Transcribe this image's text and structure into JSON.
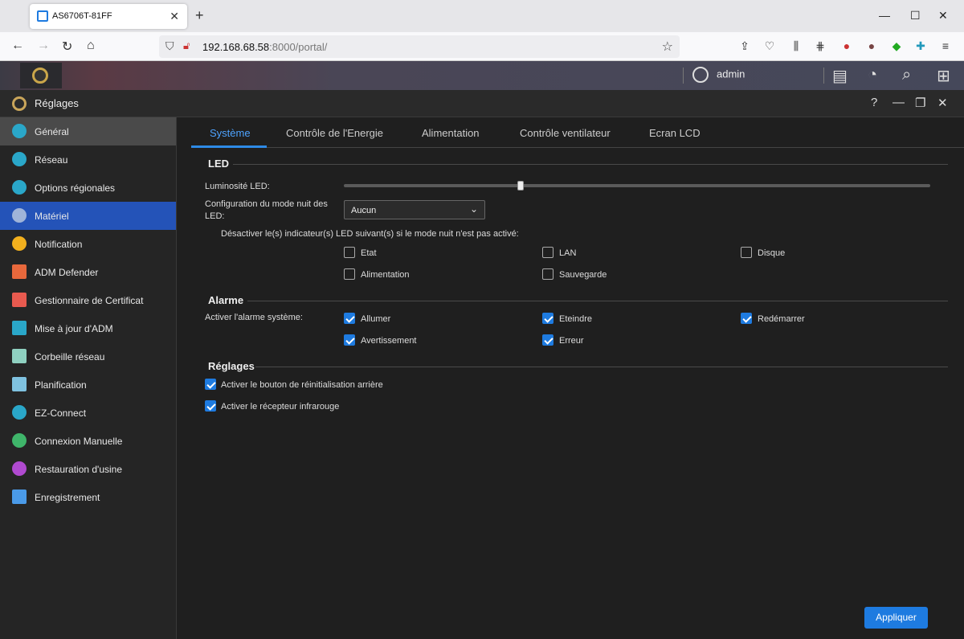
{
  "browser": {
    "tab_title": "AS6706T-81FF",
    "url_host": "192.168.68.58",
    "url_rest": ":8000/portal/"
  },
  "adm": {
    "username": "admin"
  },
  "window": {
    "title": "Réglages"
  },
  "sidebar": {
    "items": [
      {
        "label": "Général",
        "color": "#2aa7c9"
      },
      {
        "label": "Réseau",
        "color": "#2aa7c9"
      },
      {
        "label": "Options régionales",
        "color": "#2aa7c9"
      },
      {
        "label": "Matériel",
        "color": "#9fb4d9"
      },
      {
        "label": "Notification",
        "color": "#f2b01e"
      },
      {
        "label": "ADM Defender",
        "color": "#e8683c"
      },
      {
        "label": "Gestionnaire de Certificat",
        "color": "#e85a4f"
      },
      {
        "label": "Mise à jour d'ADM",
        "color": "#2aa7c9"
      },
      {
        "label": "Corbeille réseau",
        "color": "#8fd0c0"
      },
      {
        "label": "Planification",
        "color": "#7fc2e0"
      },
      {
        "label": "EZ-Connect",
        "color": "#2aa7c9"
      },
      {
        "label": "Connexion Manuelle",
        "color": "#3fb56a"
      },
      {
        "label": "Restauration d'usine",
        "color": "#b04ad0"
      },
      {
        "label": "Enregistrement",
        "color": "#4a9ae8"
      }
    ]
  },
  "tabs": [
    "Système",
    "Contrôle de l'Energie",
    "Alimentation",
    "Contrôle ventilateur",
    "Ecran LCD"
  ],
  "led": {
    "title": "LED",
    "brightness_label": "Luminosité LED:",
    "brightness_value": 0.29,
    "night_mode_label_1": "Configuration du mode nuit des",
    "night_mode_label_2": "LED:",
    "night_mode_value": "Aucun",
    "disable_text": "Désactiver le(s) indicateur(s) LED suivant(s) si le mode nuit n'est pas activé:",
    "options": [
      {
        "label": "Etat",
        "checked": false
      },
      {
        "label": "LAN",
        "checked": false
      },
      {
        "label": "Disque",
        "checked": false
      },
      {
        "label": "Alimentation",
        "checked": false
      },
      {
        "label": "Sauvegarde",
        "checked": false
      }
    ]
  },
  "alarm": {
    "title": "Alarme",
    "enable_label": "Activer l'alarme système:",
    "options": [
      {
        "label": "Allumer",
        "checked": true
      },
      {
        "label": "Eteindre",
        "checked": true
      },
      {
        "label": "Redémarrer",
        "checked": true
      },
      {
        "label": "Avertissement",
        "checked": true
      },
      {
        "label": "Erreur",
        "checked": true
      }
    ]
  },
  "settings": {
    "title": "Réglages",
    "options": [
      {
        "label": "Activer le bouton de réinitialisation arrière",
        "checked": true
      },
      {
        "label": "Activer le récepteur infrarouge",
        "checked": true
      }
    ]
  },
  "apply_label": "Appliquer"
}
